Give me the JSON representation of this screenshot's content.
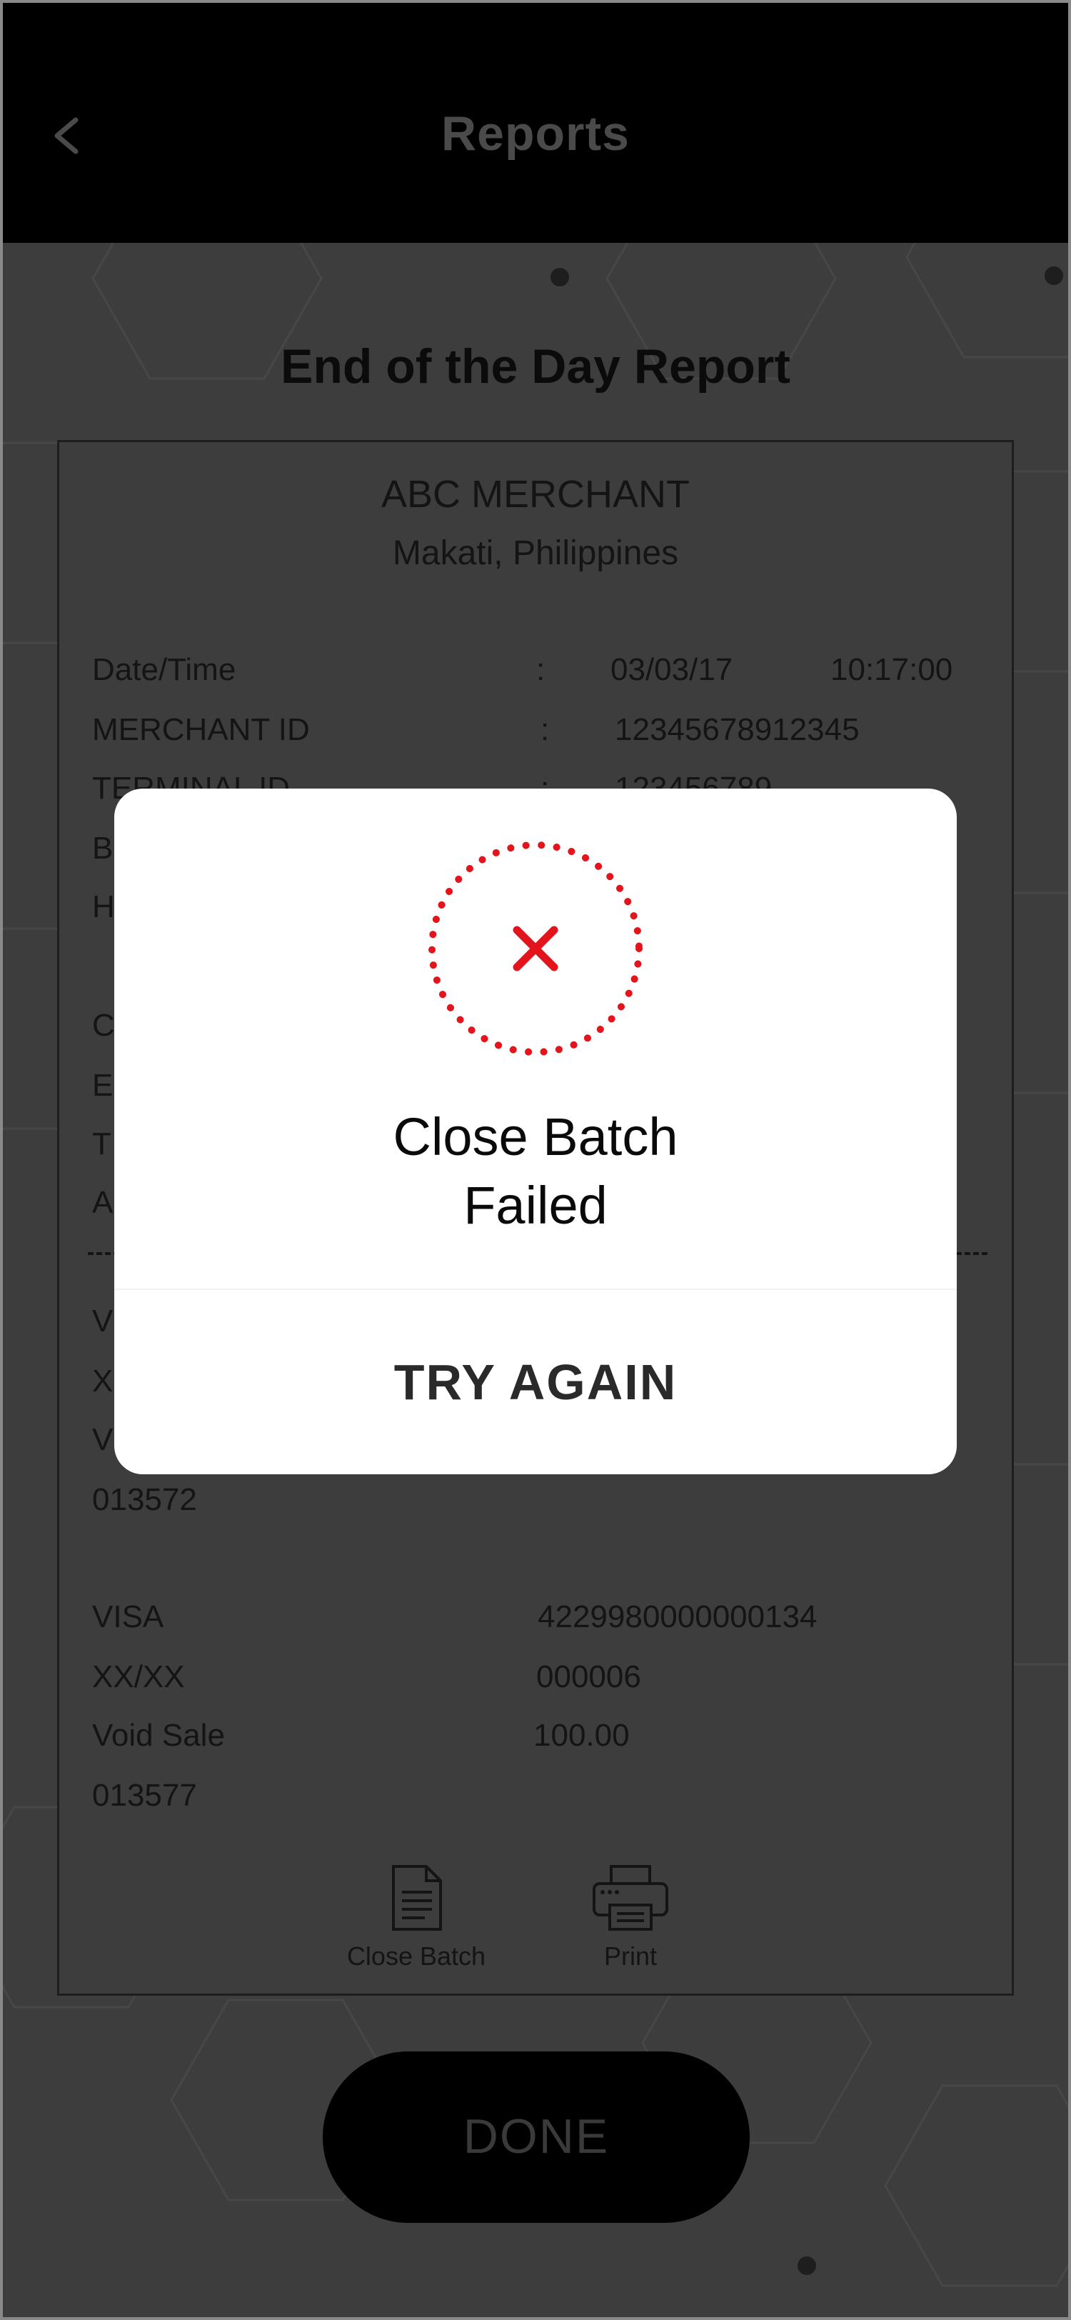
{
  "header": {
    "title": "Reports",
    "back_icon": "chevron-left-icon"
  },
  "page_title": "End of the Day Report",
  "receipt": {
    "merchant_name": "ABC MERCHANT",
    "merchant_location": "Makati, Philippines",
    "date_label": "Date/Time",
    "date_value": "03/03/17",
    "time_value": "10:17:00",
    "merchant_id_label": "MERCHANT ID",
    "merchant_id_value": "12345678912345",
    "terminal_id_label": "TERMINAL ID",
    "terminal_id_value": "123456789",
    "separator": ":",
    "partial_labels": [
      "B",
      "H",
      "C",
      "E",
      "T",
      "A"
    ],
    "txn1_partial": [
      "V",
      "X",
      "V"
    ],
    "txn1_code": "013572",
    "txn2": {
      "card": "VISA",
      "card_number": "4229980000000134",
      "expiry": "XX/XX",
      "trace": "000006",
      "type": "Void Sale",
      "amount": "100.00",
      "code": "013577"
    },
    "actions": [
      {
        "label": "Close Batch",
        "icon": "document-icon"
      },
      {
        "label": "Print",
        "icon": "printer-icon"
      }
    ]
  },
  "done_label": "DONE",
  "modal": {
    "icon": "error-x-icon",
    "message_line1": "Close Batch",
    "message_line2": "Failed",
    "button_label": "TRY AGAIN"
  },
  "colors": {
    "header_bg": "#000000",
    "page_bg": "#3d3d3d",
    "modal_bg": "#ffffff",
    "error_red": "#e3141b"
  }
}
